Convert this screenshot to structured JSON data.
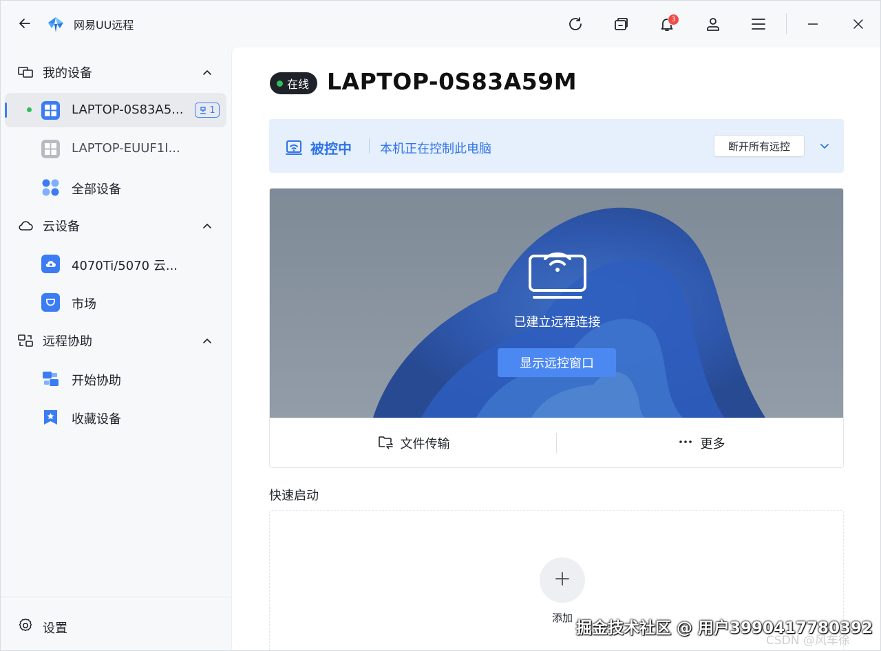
{
  "app": {
    "title": "网易UU远程",
    "notification_count": "3"
  },
  "sidebar": {
    "my_devices": {
      "label": "我的设备",
      "items": [
        {
          "label": "LAPTOP-0S83A5...",
          "online": true,
          "active": true,
          "tag": "1"
        },
        {
          "label": "LAPTOP-EUUF1I...",
          "online": false,
          "active": false
        },
        {
          "label": "全部设备"
        }
      ]
    },
    "cloud_devices": {
      "label": "云设备",
      "items": [
        {
          "label": "4070Ti/5070 云..."
        },
        {
          "label": "市场"
        }
      ]
    },
    "remote_assist": {
      "label": "远程协助",
      "items": [
        {
          "label": "开始协助"
        },
        {
          "label": "收藏设备"
        }
      ]
    },
    "settings_label": "设置"
  },
  "main": {
    "status": "在线",
    "device_name": "LAPTOP-0S83A59M",
    "banner": {
      "title": "被控中",
      "description": "本机正在控制此电脑",
      "button": "断开所有远控"
    },
    "preview": {
      "connected_text": "已建立远程连接",
      "show_button": "显示远控窗口",
      "file_transfer": "文件传输",
      "more": "更多"
    },
    "quick_launch": {
      "title": "快速启动",
      "add_label": "添加"
    }
  },
  "watermark": {
    "text": "掘金技术社区 @ 用户3990417780392",
    "secondary": "CSDN @风车徐"
  },
  "colors": {
    "accent": "#3b7cf4",
    "online": "#2ec05a",
    "badge": "#f04b45",
    "banner_bg": "#e6f0fc"
  }
}
